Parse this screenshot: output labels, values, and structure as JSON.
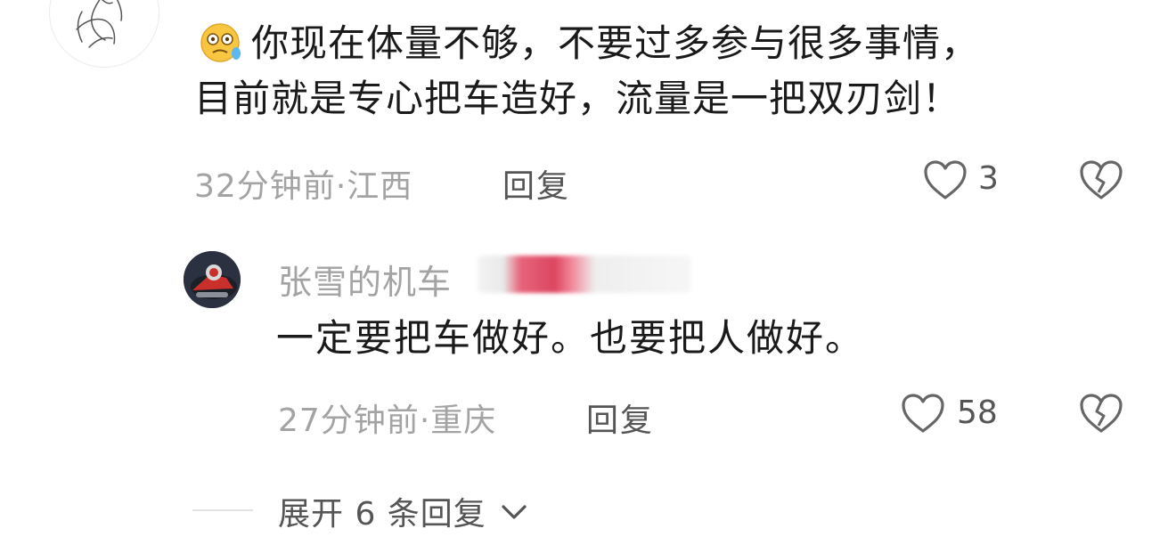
{
  "comment": {
    "emoji_icon": "woozy-face-emoji",
    "text_line1": "你现在体量不够，不要过多参与很多事情，",
    "text_line2": "目前就是专心把车造好，流量是一把双刃剑！",
    "time": "32分钟前",
    "separator": "·",
    "location": "江西",
    "reply_label": "回复",
    "like_count": "3",
    "like_icon": "heart-outline-icon",
    "dislike_icon": "broken-heart-icon"
  },
  "reply": {
    "username": "张雪的机车",
    "text": "一定要把车做好。也要把人做好。",
    "time": "27分钟前",
    "separator": "·",
    "location": "重庆",
    "reply_label": "回复",
    "like_count": "58",
    "like_icon": "heart-outline-icon",
    "dislike_icon": "broken-heart-icon"
  },
  "expand": {
    "label": "展开 6 条回复",
    "icon": "chevron-down-icon"
  },
  "colors": {
    "primary_text": "#1a1a1a",
    "meta_text": "#a3a3a3",
    "action_text": "#555555",
    "icon_stroke": "#666666"
  }
}
